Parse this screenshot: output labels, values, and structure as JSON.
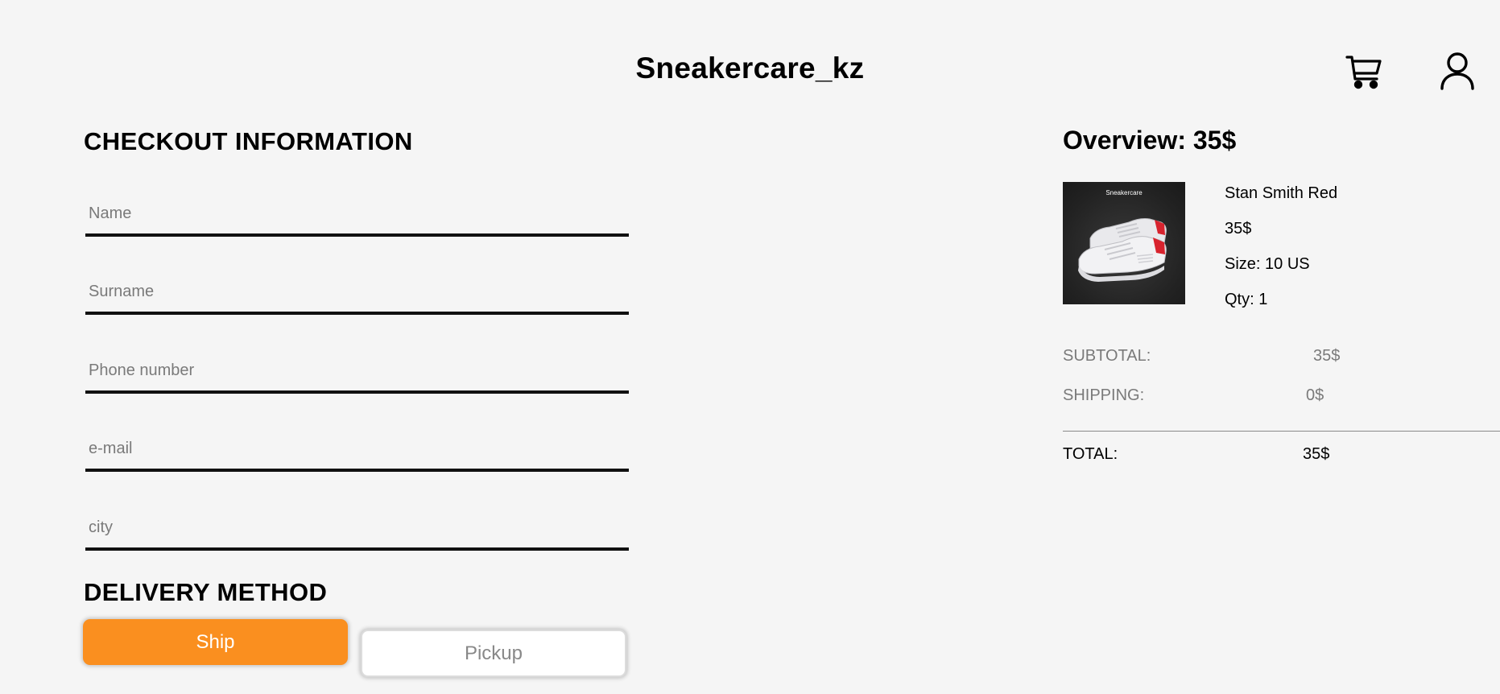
{
  "header": {
    "brand": "Sneakercare_kz",
    "icons": {
      "cart": "shopping-cart-icon",
      "user": "user-profile-icon"
    }
  },
  "checkout": {
    "title": "CHECKOUT INFORMATION",
    "fields": {
      "name": {
        "placeholder": "Name",
        "value": ""
      },
      "surname": {
        "placeholder": "Surname",
        "value": ""
      },
      "phone": {
        "placeholder": "Phone number",
        "value": ""
      },
      "email": {
        "placeholder": "e-mail",
        "value": ""
      },
      "city": {
        "placeholder": "city",
        "value": ""
      }
    }
  },
  "delivery": {
    "title": "DELIVERY METHOD",
    "options": {
      "ship": "Ship",
      "pickup": "Pickup"
    },
    "selected": "Ship"
  },
  "overview": {
    "label": "Overview:",
    "amount": "35$",
    "product": {
      "image_caption": "Sneakercare",
      "name": "Stan Smith Red",
      "price": "35$",
      "size": "Size: 10 US",
      "qty": "Qty: 1"
    },
    "summary": {
      "subtotal_label": "SUBTOTAL:",
      "subtotal_value": "35$",
      "shipping_label": "SHIPPING:",
      "shipping_value": "0$",
      "total_label": "TOTAL:",
      "total_value": "35$"
    }
  },
  "colors": {
    "background": "#f5f5f5",
    "accent": "#fa8f1f",
    "text": "#000000",
    "muted": "#7a7a7a"
  }
}
